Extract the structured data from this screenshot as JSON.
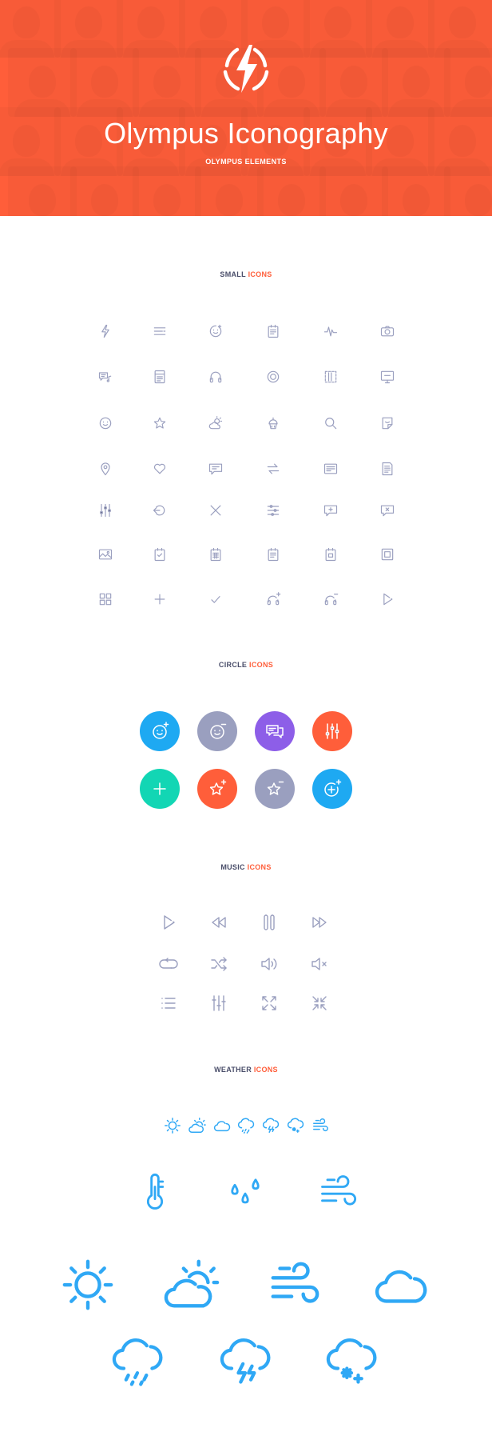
{
  "hero": {
    "title": "Olympus Iconography",
    "subtitle": "OLYMPUS ELEMENTS",
    "background_color": "#ff5e3a",
    "logo_icon": "lightning-circle-icon"
  },
  "sections": {
    "small": {
      "label": "SMALL",
      "accent": "ICONS"
    },
    "circle": {
      "label": "CIRCLE",
      "accent": "ICONS"
    },
    "music": {
      "label": "MUSIC",
      "accent": "ICONS"
    },
    "weather": {
      "label": "WEATHER",
      "accent": "ICONS"
    }
  },
  "colors": {
    "accent": "#ff5e3a",
    "icon_gray": "#9a9fbf",
    "heading": "#4a4e6a",
    "weather_blue": "#2fa8f5",
    "circle_blue": "#1ea9f2",
    "circle_gray": "#9a9fbf",
    "circle_purple": "#8d5ee8",
    "circle_orange": "#ff5e3a",
    "circle_teal": "#12d6b4"
  },
  "small_icons": [
    [
      "lightning-icon",
      "list-lines-icon",
      "happy-face-icon",
      "calendar-icon",
      "pulse-icon",
      "camera-icon"
    ],
    [
      "chat-music-icon",
      "newsfeed-icon",
      "headphones-icon",
      "record-icon",
      "columns-icon",
      "monitor-icon"
    ],
    [
      "smile-icon",
      "star-icon",
      "weather-sun-cloud-icon",
      "cupcake-icon",
      "search-icon",
      "sticker-icon"
    ],
    [
      "map-pin-icon",
      "heart-icon",
      "comment-icon",
      "swap-arrows-icon",
      "article-icon",
      "document-icon"
    ],
    [
      "equalizer-icon",
      "back-circle-icon",
      "close-x-icon",
      "sliders-icon",
      "add-comment-icon",
      "delete-comment-icon"
    ],
    [
      "photo-icon",
      "checked-calendar-icon",
      "calendar-grid-icon",
      "schedule-icon",
      "event-icon",
      "framed-square-icon"
    ],
    [
      "grid-menu-icon",
      "plus-icon",
      "checkmark-icon",
      "add-headphones-icon",
      "remove-headphones-icon",
      "play-icon"
    ]
  ],
  "circle_icons": [
    [
      {
        "icon": "add-happy-face-icon",
        "color": "#1ea9f2"
      },
      {
        "icon": "remove-happy-face-icon",
        "color": "#9a9fbf"
      },
      {
        "icon": "chat-messages-icon",
        "color": "#8d5ee8"
      },
      {
        "icon": "equalizer-icon",
        "color": "#ff5e3a"
      }
    ],
    [
      {
        "icon": "plus-icon",
        "color": "#12d6b4"
      },
      {
        "icon": "add-star-icon",
        "color": "#ff5e3a"
      },
      {
        "icon": "remove-star-icon",
        "color": "#9a9fbf"
      },
      {
        "icon": "add-circle-icon",
        "color": "#1ea9f2"
      }
    ]
  ],
  "music_icons": [
    [
      "play-icon",
      "rewind-icon",
      "pause-icon",
      "fast-forward-icon"
    ],
    [
      "repeat-icon",
      "shuffle-icon",
      "volume-icon",
      "mute-icon"
    ],
    [
      "playlist-icon",
      "mixer-icon",
      "expand-icon",
      "collapse-icon"
    ]
  ],
  "weather_icons": {
    "small_row": [
      "sun-icon",
      "sun-cloud-icon",
      "cloud-icon",
      "cloud-rain-icon",
      "cloud-thunder-icon",
      "cloud-snow-icon",
      "wind-icon"
    ],
    "medium_row": [
      "thermometer-icon",
      "raindrops-icon",
      "wind-icon"
    ],
    "large_row": [
      "sun-icon",
      "sun-cloud-icon",
      "wind-icon",
      "cloud-icon"
    ],
    "xlarge_row": [
      "cloud-rain-icon",
      "cloud-thunder-icon",
      "cloud-snow-icon"
    ]
  }
}
